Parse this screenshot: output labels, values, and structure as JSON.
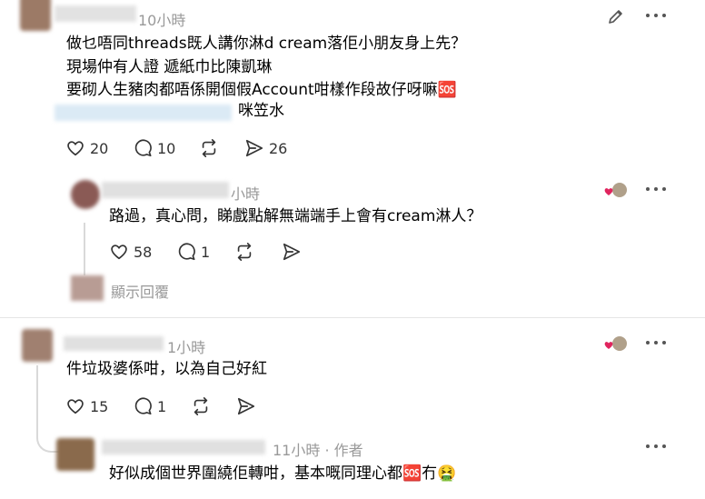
{
  "post1": {
    "time": "10小時",
    "lines": [
      "做乜唔同threads既人講你淋d cream落佢小朋友身上先？",
      "現場仲有人證 遞紙巾比陳凱琳",
      "要砌人生豬肉都唔係開個假Account咁樣作段故仔呀嘛🆘"
    ],
    "tag_suffix": "咪笠水",
    "likes": "20",
    "replies": "10",
    "shares": "26"
  },
  "reply1": {
    "time": "小時",
    "text": "路過，真心問，睇戲點解無端端手上會有cream淋人？",
    "likes": "58",
    "replies": "1",
    "show_replies": "顯示回覆"
  },
  "post2": {
    "time": "1小時",
    "text": "件垃圾婆係咁，以為自己好紅",
    "likes": "15",
    "replies": "1"
  },
  "reply2": {
    "time": "11小時 · 作者",
    "text": "好似成個世界圍繞佢轉咁，基本嘅同理心都🆘冇🤮"
  },
  "icons": [
    "edit-icon",
    "more-icon",
    "heart-icon",
    "comment-icon",
    "repost-icon",
    "share-icon"
  ],
  "colors": {
    "meta": "#999999",
    "divider": "#e5e5e5",
    "heart_badge": "#e0245e"
  }
}
